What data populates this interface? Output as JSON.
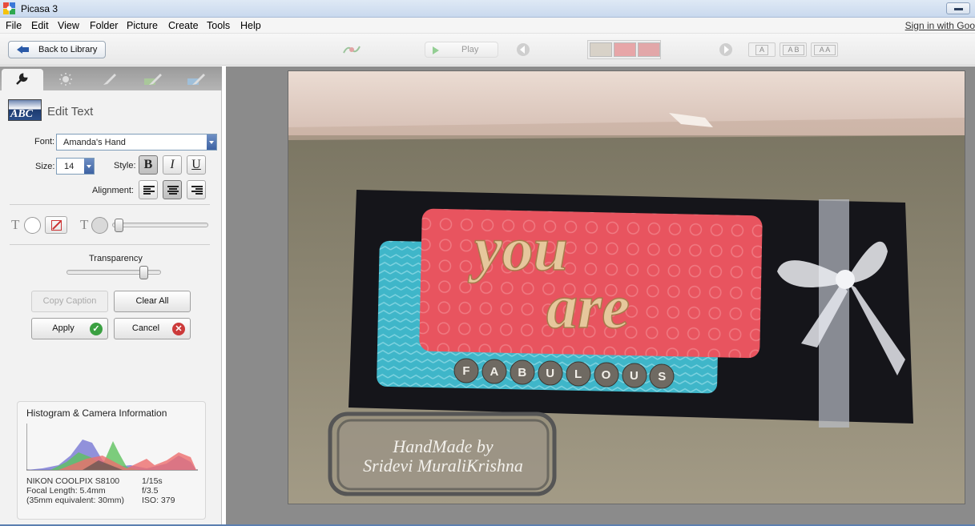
{
  "window": {
    "title": "Picasa 3",
    "app_icon": "picasa-pinwheel-icon",
    "minimize_icon": "minimize-icon"
  },
  "menu": {
    "items": [
      {
        "label": "File",
        "key": "F"
      },
      {
        "label": "Edit",
        "key": "E"
      },
      {
        "label": "View",
        "key": "V"
      },
      {
        "label": "Folder",
        "key": "F"
      },
      {
        "label": "Picture",
        "key": "P"
      },
      {
        "label": "Create",
        "key": "C"
      },
      {
        "label": "Tools",
        "key": "T"
      },
      {
        "label": "Help",
        "key": "H"
      }
    ],
    "signin": "Sign in with Goo"
  },
  "toolbar": {
    "back_label": "Back to Library",
    "play_label": "Play",
    "caption_modes": [
      "A",
      "A B",
      "A A"
    ],
    "icons": [
      "slideshow-icon",
      "play-icon",
      "prev-arrow-icon",
      "next-arrow-icon"
    ]
  },
  "left_panel": {
    "tabs": [
      {
        "name": "basic-fixes",
        "icon": "wrench-icon",
        "active": true
      },
      {
        "name": "tuning",
        "icon": "sun-icon",
        "active": false
      },
      {
        "name": "effects-1",
        "icon": "brush-icon",
        "active": false
      },
      {
        "name": "effects-2",
        "icon": "brush-green-icon",
        "active": false
      },
      {
        "name": "effects-3",
        "icon": "brush-blue-icon",
        "active": false
      }
    ],
    "header": {
      "title": "Edit Text",
      "thumb_text": "ABC"
    },
    "font": {
      "label": "Font:",
      "value": "Amanda's Hand"
    },
    "size": {
      "label": "Size:",
      "value": "14"
    },
    "style": {
      "label": "Style:",
      "bold": "B",
      "italic": "I",
      "underline": "U",
      "bold_on": true
    },
    "alignment": {
      "label": "Alignment:",
      "selected": "center"
    },
    "color_row": {
      "text_glyph": "T",
      "outline_glyph": "T"
    },
    "outline_thickness": 0.03,
    "transparency": {
      "label": "Transparency",
      "value": 0.85
    },
    "buttons": {
      "copy_caption": "Copy Caption",
      "clear_all": "Clear All",
      "apply": "Apply",
      "cancel": "Cancel"
    },
    "histogram": {
      "title": "Histogram & Camera Information",
      "camera": "NIKON COOLPIX S8100",
      "focal_length": "Focal Length: 5.4mm",
      "equiv": "(35mm equivalent:  30mm)",
      "shutter": "1/15s",
      "aperture": "f/3.5",
      "iso": "ISO: 379"
    }
  },
  "photo": {
    "card_text_line1": "you",
    "card_text_line2": "are",
    "card_letters": [
      "F",
      "A",
      "B",
      "U",
      "L",
      "O",
      "U",
      "S"
    ],
    "watermark_line1": "HandMade by",
    "watermark_line2": "Sridevi MuraliKrishna",
    "colors": {
      "card_pink": "#e8545f",
      "card_blue": "#3fb6c9",
      "card_black": "#15151a",
      "wall": "#d9c2b8",
      "floor": "#8d8470"
    }
  }
}
